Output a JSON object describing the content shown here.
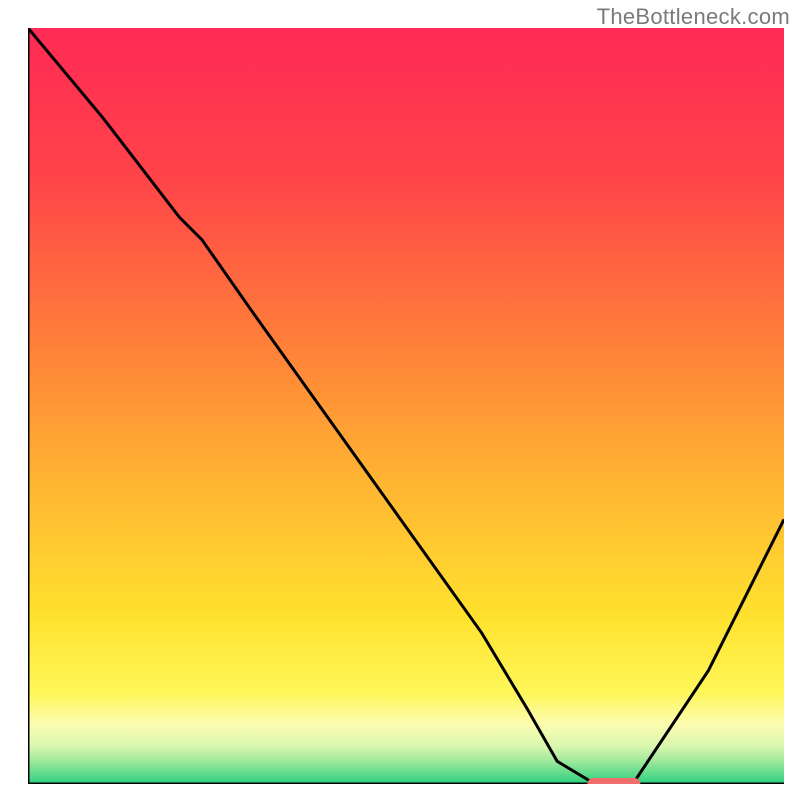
{
  "watermark": "TheBottleneck.com",
  "chart_data": {
    "type": "line",
    "title": "",
    "xlabel": "",
    "ylabel": "",
    "xlim": [
      0,
      100
    ],
    "ylim": [
      0,
      100
    ],
    "grid": false,
    "legend": false,
    "series": [
      {
        "name": "curve",
        "color": "#000000",
        "x": [
          0,
          10,
          20,
          23,
          30,
          40,
          50,
          60,
          66,
          70,
          75,
          80,
          90,
          100
        ],
        "y": [
          100,
          88,
          75,
          72,
          62,
          48,
          34,
          20,
          10,
          3,
          0,
          0,
          15,
          35
        ]
      }
    ],
    "marker": {
      "name": "optimal-range",
      "color": "#ef6d6a",
      "x_start": 74,
      "x_end": 81,
      "y": 0
    },
    "background_gradient": {
      "stops": [
        {
          "offset": 0,
          "color": "#ff2a55"
        },
        {
          "offset": 20,
          "color": "#ff4449"
        },
        {
          "offset": 40,
          "color": "#ff7b3a"
        },
        {
          "offset": 60,
          "color": "#ffb432"
        },
        {
          "offset": 78,
          "color": "#ffe22e"
        },
        {
          "offset": 88,
          "color": "#fff75a"
        },
        {
          "offset": 92,
          "color": "#fdfcb0"
        },
        {
          "offset": 95,
          "color": "#d9f7af"
        },
        {
          "offset": 97,
          "color": "#9fe89c"
        },
        {
          "offset": 100,
          "color": "#29d07e"
        }
      ]
    }
  }
}
